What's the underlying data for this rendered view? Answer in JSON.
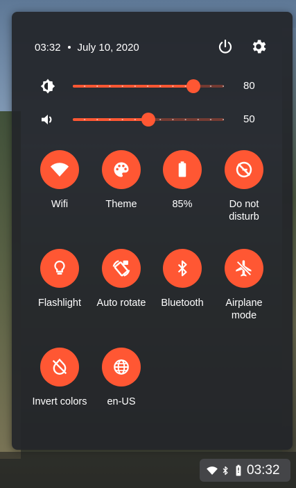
{
  "header": {
    "time": "03:32",
    "date": "July 10, 2020"
  },
  "brightness": {
    "value": 80,
    "label": "80"
  },
  "volume": {
    "value": 50,
    "label": "50"
  },
  "tiles": [
    {
      "id": "wifi",
      "label": "Wifi",
      "icon": "wifi-icon"
    },
    {
      "id": "theme",
      "label": "Theme",
      "icon": "palette-icon"
    },
    {
      "id": "battery",
      "label": "85%",
      "icon": "battery-icon"
    },
    {
      "id": "dnd",
      "label": "Do not disturb",
      "icon": "do-not-disturb-icon"
    },
    {
      "id": "flashlight",
      "label": "Flashlight",
      "icon": "flashlight-icon"
    },
    {
      "id": "autorotate",
      "label": "Auto rotate",
      "icon": "auto-rotate-icon"
    },
    {
      "id": "bluetooth",
      "label": "Bluetooth",
      "icon": "bluetooth-icon"
    },
    {
      "id": "airplane",
      "label": "Airplane mode",
      "icon": "airplane-icon"
    },
    {
      "id": "invert",
      "label": "Invert colors",
      "icon": "invert-colors-icon"
    },
    {
      "id": "locale",
      "label": "en-US",
      "icon": "globe-icon"
    }
  ],
  "tray": {
    "time": "03:32"
  },
  "colors": {
    "accent": "#ff5733",
    "panel": "#222529"
  }
}
